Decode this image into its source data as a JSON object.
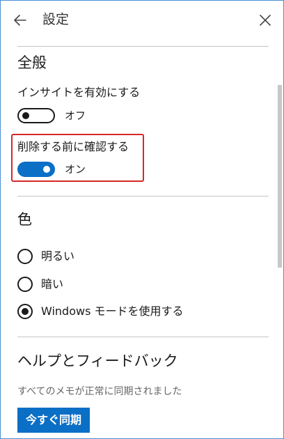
{
  "header": {
    "title": "設定",
    "back_icon": "arrow-left-icon",
    "close_icon": "close-icon"
  },
  "general": {
    "title": "全般",
    "insights": {
      "label": "インサイトを有効にする",
      "state_label": "オフ",
      "on": false
    },
    "confirm_delete": {
      "label": "削除する前に確認する",
      "state_label": "オン",
      "on": true
    }
  },
  "color": {
    "title": "色",
    "options": [
      {
        "label": "明るい",
        "selected": false
      },
      {
        "label": "暗い",
        "selected": false
      },
      {
        "label": "Windows モードを使用する",
        "selected": true
      }
    ]
  },
  "help": {
    "title": "ヘルプとフィードバック",
    "sync_status": "すべてのメモが正常に同期されました",
    "sync_button": "今すぐ同期"
  },
  "colors": {
    "accent": "#0b6fc6",
    "highlight": "#d62828",
    "window_border": "#4a8fd4"
  }
}
